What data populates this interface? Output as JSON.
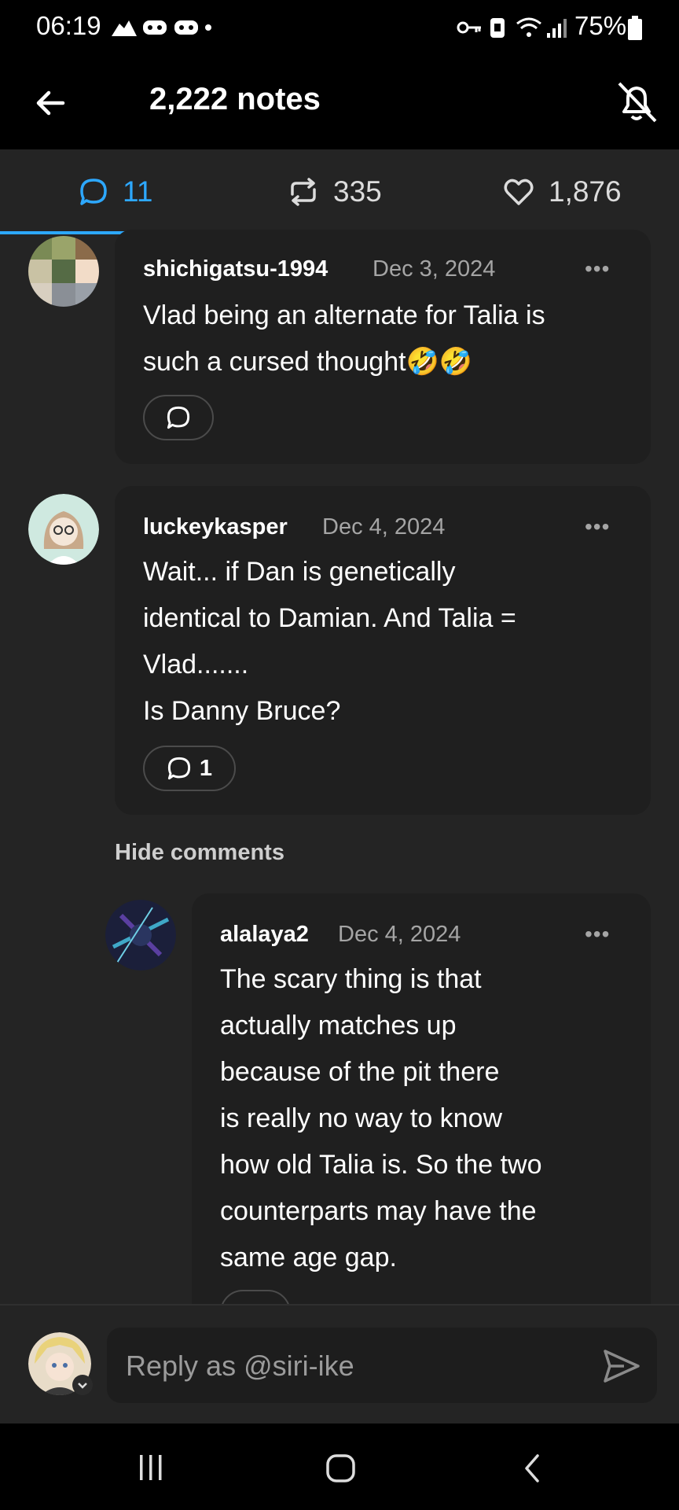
{
  "status_bar": {
    "time": "06:19",
    "battery": "75%",
    "icons": [
      "cloud-icon",
      "game-icon",
      "game-icon",
      "dot-icon",
      "key-icon",
      "security-icon",
      "wifi-icon",
      "signal-icon",
      "battery-icon"
    ]
  },
  "header": {
    "title": "2,222 notes",
    "back_icon": "arrow-left-icon",
    "mute_icon": "bell-off-icon"
  },
  "tabs": [
    {
      "label": "11",
      "icon": "comment-icon",
      "active": true
    },
    {
      "label": "335",
      "icon": "reblog-icon",
      "active": false
    },
    {
      "label": "1,876",
      "icon": "heart-icon",
      "active": false
    }
  ],
  "comments": [
    {
      "username": "shichigatsu-1994",
      "date": "Dec 3, 2024",
      "lines": [
        "Vlad being an alternate for Talia is",
        "such a cursed thought🤣🤣"
      ],
      "reply_count": ""
    },
    {
      "username": "luckeykasper",
      "date": "Dec 4, 2024",
      "lines": [
        "Wait... if Dan is genetically",
        "identical to Damian. And Talia =",
        "Vlad.......",
        "Is Danny Bruce?"
      ],
      "reply_count": "1"
    }
  ],
  "hide_comments_label": "Hide comments",
  "replies": [
    {
      "username": "alalaya2",
      "date": "Dec 4, 2024",
      "lines": [
        "The scary thing is that",
        "actually matches up",
        "because of the pit there",
        "is really no way to know",
        "how old Talia is. So the two",
        "counterparts may have the",
        "same age gap."
      ]
    }
  ],
  "more_label": "•••",
  "reply_bar": {
    "placeholder": "Reply as @siri-ike",
    "send_icon": "send-icon"
  },
  "nav_bar": {
    "icons": [
      "recents-icon",
      "home-icon",
      "back-icon"
    ]
  },
  "colors": {
    "accent": "#2da8ff",
    "background": "#242424",
    "card": "#1f1f1f",
    "muted_text": "#a5a5a5"
  }
}
